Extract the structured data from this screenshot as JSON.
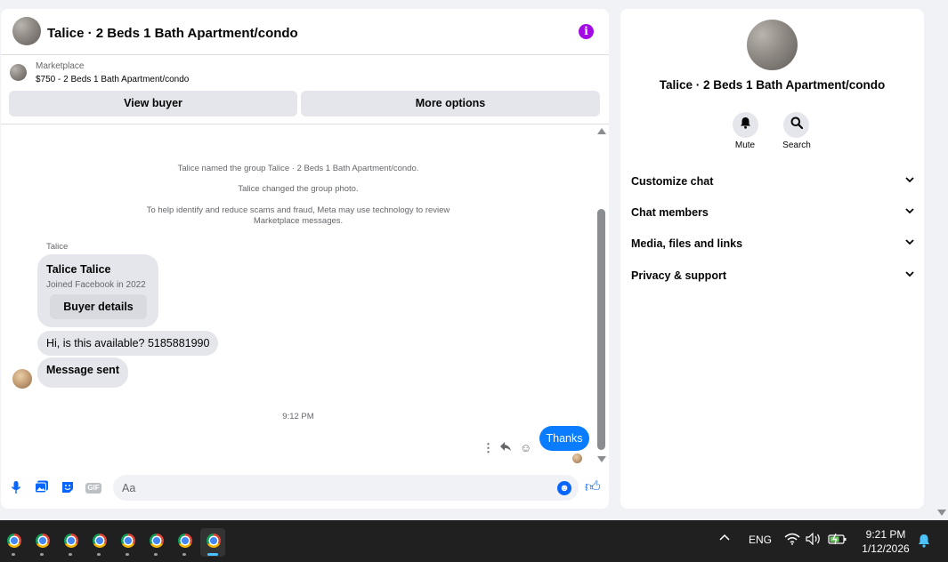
{
  "chat": {
    "title": "Talice · 2 Beds 1 Bath Apartment/condo",
    "marketplace_label": "Marketplace",
    "listing": "$750 - 2 Beds 1 Bath Apartment/condo",
    "view_buyer": "View buyer",
    "more_options": "More options",
    "system_messages": [
      "Talice named the group Talice · 2 Beds 1 Bath Apartment/condo.",
      "Talice changed the group photo.",
      "To help identify and reduce scams and fraud, Meta may use technology to review",
      "Marketplace messages."
    ],
    "sender": "Talice",
    "buyer_card": {
      "name": "Talice Talice",
      "joined": "Joined Facebook in 2022",
      "details_button": "Buyer details"
    },
    "messages_in": [
      "Hi, is this available? 5185881990",
      "Message sent"
    ],
    "timestamp": "9:12 PM",
    "message_out": "Thanks",
    "input_placeholder": "Aa",
    "gif_label": "GIF"
  },
  "details": {
    "name": "Talice · 2 Beds 1 Bath Apartment/condo",
    "mute_label": "Mute",
    "search_label": "Search",
    "sections": [
      "Customize chat",
      "Chat members",
      "Media, files and links",
      "Privacy & support"
    ]
  },
  "taskbar": {
    "language": "ENG",
    "time": "9:21 PM",
    "date": "1/12/2026"
  },
  "colors": {
    "accent": "#0866ff",
    "outgoing_bubble": "#0a7cff",
    "info_icon": "#a40ae6",
    "taskbar": "#202020"
  }
}
